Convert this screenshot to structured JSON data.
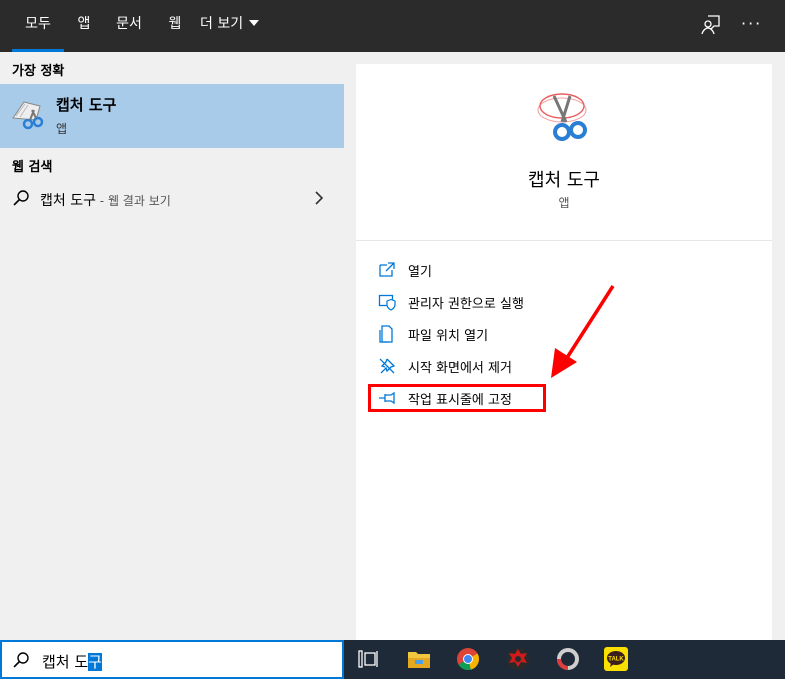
{
  "tabs": {
    "all": "모두",
    "app": "앱",
    "doc": "문서",
    "web": "웹",
    "more": "더 보기"
  },
  "left": {
    "best_match_header": "가장 정확",
    "best_match": {
      "title": "캡처 도구",
      "subtitle": "앱"
    },
    "web_search_header": "웹 검색",
    "web_search": {
      "query": "캡처 도구",
      "suffix": " - 웹 결과 보기"
    }
  },
  "right": {
    "app_title": "캡처 도구",
    "app_type": "앱",
    "actions": [
      {
        "label": "열기",
        "icon": "open-icon"
      },
      {
        "label": "관리자 권한으로 실행",
        "icon": "admin-shield-icon"
      },
      {
        "label": "파일 위치 열기",
        "icon": "file-location-icon"
      },
      {
        "label": "시작 화면에서 제거",
        "icon": "unpin-icon"
      },
      {
        "label": "작업 표시줄에 고정",
        "icon": "pin-icon"
      }
    ]
  },
  "search": {
    "typed": "캡처 도",
    "selected": "구"
  },
  "colors": {
    "accent": "#0078d7",
    "highlight": "#ff0000",
    "selected_row": "#a8cbea"
  }
}
